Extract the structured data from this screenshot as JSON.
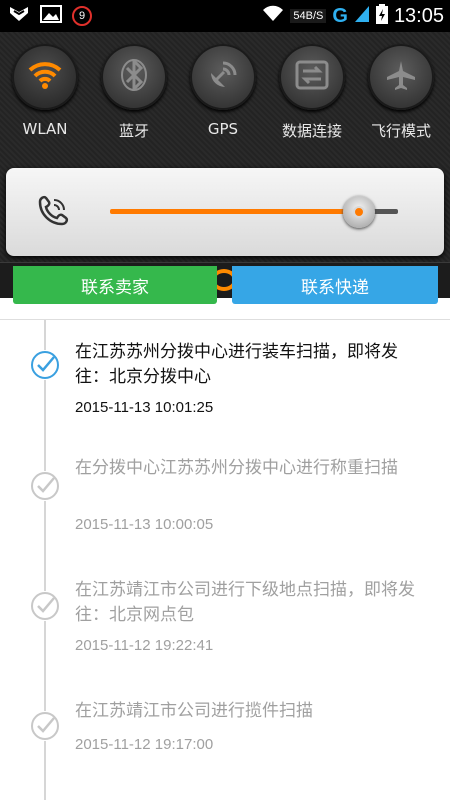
{
  "status_bar": {
    "notification_badge": "9",
    "net_speed": "54B/S",
    "network_type": "G",
    "time": "13:05"
  },
  "quick_settings": {
    "toggles": [
      {
        "label": "WLAN",
        "icon": "wifi-icon",
        "active": true
      },
      {
        "label": "蓝牙",
        "icon": "bluetooth-icon",
        "active": false
      },
      {
        "label": "GPS",
        "icon": "gps-icon",
        "active": false
      },
      {
        "label": "数据连接",
        "icon": "data-connection-icon",
        "active": false
      },
      {
        "label": "飞行模式",
        "icon": "airplane-icon",
        "active": false
      }
    ],
    "volume": {
      "icon": "ringtone-icon",
      "level": 0.85,
      "accent": "#ff7a00"
    }
  },
  "actions": {
    "contact_seller": "联系卖家",
    "contact_express": "联系快递",
    "seller_color": "#35b84c",
    "express_color": "#36a6e6"
  },
  "timeline": [
    {
      "text": "在江苏苏州分拨中心进行装车扫描，即将发往：北京分拨中心",
      "time": "2015-11-13 10:01:25",
      "current": true
    },
    {
      "text": "在分拨中心江苏苏州分拨中心进行称重扫描",
      "time": "2015-11-13 10:00:05",
      "current": false
    },
    {
      "text": "在江苏靖江市公司进行下级地点扫描，即将发往：北京网点包",
      "time": "2015-11-12 19:22:41",
      "current": false
    },
    {
      "text": "在江苏靖江市公司进行揽件扫描",
      "time": "2015-11-12 19:17:00",
      "current": false
    }
  ]
}
